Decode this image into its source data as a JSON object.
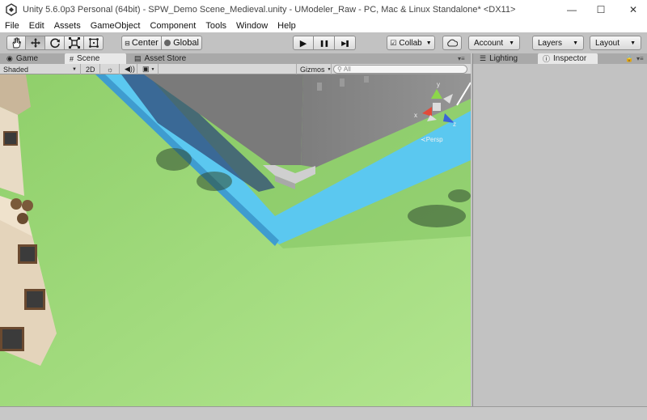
{
  "window": {
    "title": "Unity 5.6.0p3 Personal (64bit) - SPW_Demo Scene_Medieval.unity - UModeler_Raw - PC, Mac & Linux Standalone* <DX11>",
    "minimize": "—",
    "maximize": "☐",
    "close": "✕"
  },
  "menu": [
    "File",
    "Edit",
    "Assets",
    "GameObject",
    "Component",
    "Tools",
    "Window",
    "Help"
  ],
  "toolbar": {
    "pivot_label": "Center",
    "space_label": "Global",
    "play": "▶",
    "pause": "❚❚",
    "step": "▶❚",
    "collab_label": "Collab",
    "account_label": "Account",
    "layers_label": "Layers",
    "layout_label": "Layout"
  },
  "tabs": {
    "game": "Game",
    "scene": "Scene",
    "asset_store": "Asset Store",
    "lighting": "Lighting",
    "inspector": "Inspector"
  },
  "scene_toolbar": {
    "shading_mode": "Shaded",
    "mode_2d": "2D",
    "gizmos_label": "Gizmos",
    "search_placeholder": "All"
  },
  "gizmo": {
    "y_label": "y",
    "x_label": "x",
    "z_label": "z",
    "projection": "Persp"
  },
  "colors": {
    "grass": "#9ed87b",
    "water": "#5bc8f0",
    "wall": "#8c8c8c",
    "shadow": "#3a4a6a"
  }
}
